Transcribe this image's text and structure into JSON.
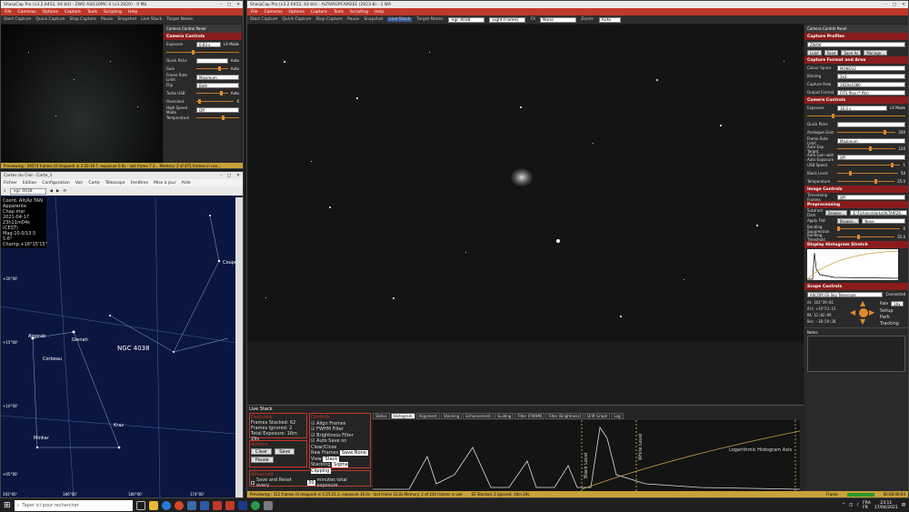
{
  "small_window": {
    "title": "SharpCap Pro (v3.2.6452, 64 bit) - ZWO ASI120MC-S (v3.2020) - 0 Mb",
    "menu": [
      "File",
      "Cameras",
      "Options",
      "Capture",
      "Tools",
      "Scripting",
      "Help"
    ],
    "toolbar": [
      "Start Capture",
      "Quick Capture",
      "Stop Capture",
      "Pause",
      "Snapshot",
      "Live Stack",
      "Target Name:"
    ],
    "panel_title": "Camera Control Panel",
    "section": "Camera Controls",
    "controls": [
      {
        "label": "Exposure",
        "value": "0.83 s",
        "extra": "LX Mode"
      },
      {
        "label": "Quick Picks",
        "value": "",
        "extra": "Auto"
      },
      {
        "label": "Gain",
        "value": "34",
        "extra": "Auto"
      },
      {
        "label": "Frame Rate Limit",
        "value": "Maximum",
        "extra": ""
      },
      {
        "label": "Flip",
        "value": "Both",
        "extra": ""
      },
      {
        "label": "Turbo USB",
        "value": "",
        "extra": "Auto"
      },
      {
        "label": "Overclock",
        "value": "0",
        "extra": ""
      },
      {
        "label": "High Speed Mode",
        "value": "Off",
        "extra": ""
      },
      {
        "label": "Temperature",
        "value": "",
        "extra": ""
      }
    ],
    "status": "Previewing : 28574 frames (0 dropped) in 2:20:16.7, exposure 0.8s - last frame 7.3... Memory: 2 of 871 frames in use..."
  },
  "cdc_window": {
    "title": "Cartes du Ciel - Carte_1",
    "menu": [
      "Fichier",
      "Edition",
      "Configuration",
      "Voir",
      "Carte",
      "Télescope",
      "Fenêtres",
      "Mise à jour",
      "Aide"
    ],
    "search": "ngc 4038",
    "info_lines": [
      "Coord. Alt/Az TAN",
      "Apparente",
      "Chap mar",
      "2021-04-17",
      "23h11m04s (CEST)",
      "Mag:10.0/13.5 5.6°",
      "Champ:+16°15'15\""
    ],
    "labels": {
      "ngc": "NGC 4038",
      "corbeau": "Corbeau",
      "gienah": "Gienah",
      "algorab": "Algorab",
      "kraz": "Kraz",
      "minkar": "Minkar",
      "alchiba": "Alchiba",
      "coupe": "Coupe",
      "tick1": "+20°00'",
      "tick2": "+15°00'",
      "tick3": "+10°00'",
      "tick4": "+05°00'",
      "bottom1": "192°00'",
      "bottom2": "186°00'",
      "bottom3": "180°00'",
      "bottom4": "174°00'"
    }
  },
  "main_window": {
    "title": "SharpCap Pro (v3.2.6452, 64 bit) - ALTAIRGPCAM2EE (2023-8) - 1 WA",
    "menu": [
      "File",
      "Cameras",
      "Options",
      "Capture",
      "Tools",
      "Scripting",
      "Help"
    ],
    "toolbar": {
      "start": "Start Capture",
      "quick": "Quick Capture",
      "stop": "Stop Capture",
      "pause": "Pause",
      "snapshot": "Snapshot",
      "live": "Live Stack",
      "target_label": "Target Name:",
      "target": "ngc 4038",
      "frames": "Light Frames",
      "fx": "FX",
      "fx_val": "None",
      "zoom_label": "Zoom:",
      "zoom": "Auto"
    },
    "panel_title": "Camera Control Panel",
    "capture_profiles": {
      "title": "Capture Profiles",
      "value": "ZWO6",
      "buttons": [
        "Load",
        "Save",
        "Save As",
        "Manage..."
      ]
    },
    "capture_format": {
      "title": "Capture Format and Area",
      "rows": [
        [
          "Colour Space",
          "MONO12"
        ],
        [
          "Binning",
          "3x3"
        ],
        [
          "Capture Area",
          "1920x1080"
        ],
        [
          "Output Format",
          "FITS files (*.fits)"
        ]
      ]
    },
    "camera_controls": {
      "title": "Camera Controls",
      "rows": [
        [
          "Exposure",
          "16.0 s",
          "LX Mode"
        ],
        [
          "Quick Picks",
          "",
          ""
        ],
        [
          "Analogue Gain",
          "",
          "200"
        ],
        [
          "Frame Rate Limit",
          "Maximum",
          ""
        ],
        [
          "Auto Exp Target",
          "",
          "120"
        ],
        [
          "Auto Gain with Auto Exposure",
          "Off",
          ""
        ],
        [
          "USB Speed",
          "",
          "1"
        ],
        [
          "Black Level",
          "",
          "50"
        ],
        [
          "Temperature",
          "",
          "25.0"
        ]
      ]
    },
    "image_controls": {
      "title": "Image Controls",
      "rows": [
        [
          "Timestamp Frames",
          "Off"
        ]
      ]
    },
    "preprocessing": {
      "title": "Preprocessing",
      "rows": [
        [
          "Subtract Dark",
          "Browse...",
          "E:\\Fichiers\\darks\\ALTAIR26..."
        ],
        [
          "Apply Flat",
          "Browse...",
          "None"
        ],
        [
          "Banding Suppression",
          "",
          "0"
        ],
        [
          "Banding Threshold",
          "",
          "35.0"
        ]
      ]
    },
    "histogram_title": "Display Histogram Stretch",
    "scope": {
      "title": "Scope Controls",
      "name": "ASCOM GS Sky Telescope",
      "connected": "Connected",
      "az": "163°39:01",
      "alt": "+19°53:15",
      "ra": "12:02:09",
      "dec": "-18:59:28",
      "rate_label": "Rate",
      "rate": "16x",
      "buttons": [
        "Setup",
        "Park",
        "Tracking"
      ],
      "az_l": "Az",
      "alt_l": "Alt",
      "ra_l": "RA",
      "dec_l": "Dec"
    },
    "notes_label": "Notes",
    "live_stack": {
      "title": "Live Stack",
      "overview": {
        "label": "Overview",
        "frames_stacked": "Frames Stacked: 62",
        "frames_ignored": "Frames Ignored: 2",
        "total_exposure": "Total Exposure: 16m 29s"
      },
      "actions": {
        "label": "Actions",
        "clear": "Clear",
        "save": "Save",
        "pause": "Pause"
      },
      "advanced": {
        "label": "Advanced",
        "save_reset": "Save and Reset every",
        "minutes": "minutes total exposure",
        "value": "30"
      },
      "controls": {
        "label": "Controls",
        "align": "Align Frames",
        "fwhm": "FWHM Filter",
        "bright": "Brightness Filter",
        "autosave": "Auto Save on Clear/Close",
        "raw_label": "Raw Frames",
        "raw": "Save None",
        "view_label": "View",
        "view": "Stack",
        "stacking_label": "Stacking",
        "stacking": "Sigma Clipping"
      },
      "tabs": [
        "Status",
        "Histogram",
        "Alignment",
        "Stacking",
        "Enhancement",
        "Guiding",
        "Filter (FWHM)",
        "Filter (Brightness)",
        "Drift Graph",
        "Log"
      ],
      "curve_legend": "Logarithmic Histogram Axis",
      "black_label": "Black Level",
      "white_label": "White Level"
    },
    "status": "Previewing : 312 frames (0 dropped) in 1:25:21.2, exposure 16.0s - last frame 16.0s Memory: 2 of 236 frames in use",
    "status2": "62 Stacked, 2 Ignored, 16m 29s",
    "frame_label": "Frame",
    "time_readout": "00:00:00:04"
  },
  "taskbar": {
    "search": "Taper ici pour rechercher",
    "lang": "FRA",
    "lang2": "FR",
    "time": "23:11",
    "date": "17/04/2021"
  }
}
